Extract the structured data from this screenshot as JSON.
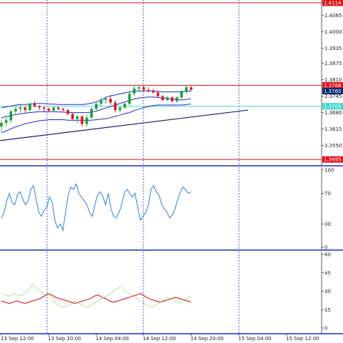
{
  "chart_data": [
    {
      "type": "candlestick",
      "panel": "price",
      "y_ticks": [
        "1.4065",
        "1.4000",
        "1.3935",
        "1.3875",
        "1.3810",
        "1.3745",
        "1.3680",
        "1.3615",
        "1.3550"
      ],
      "ylim": [
        1.347,
        1.4125
      ],
      "price_labels": [
        {
          "text": "1.4114",
          "value": 1.4114,
          "bg": "#e0141e"
        },
        {
          "text": "1.3788",
          "value": 1.3788,
          "bg": "#e0141e"
        },
        {
          "text": "1.3765",
          "value": 1.3765,
          "bg": "#0a2a6e"
        },
        {
          "text": "1.3705",
          "value": 1.3705,
          "bg": "#40d8d0"
        },
        {
          "text": "1.3495",
          "value": 1.3495,
          "bg": "#e0141e"
        }
      ],
      "horizontal_levels": [
        {
          "value": 1.4114,
          "color": "#e0141e"
        },
        {
          "value": 1.3788,
          "color": "#e0141e"
        },
        {
          "value": 1.3705,
          "color": "#40d8d0"
        },
        {
          "value": 1.3495,
          "color": "#e0141e"
        }
      ],
      "candles": [
        [
          1.3625,
          1.365,
          1.3605,
          1.364
        ],
        [
          1.364,
          1.366,
          1.3625,
          1.365
        ],
        [
          1.365,
          1.369,
          1.364,
          1.3685
        ],
        [
          1.3685,
          1.3705,
          1.367,
          1.3695
        ],
        [
          1.3695,
          1.371,
          1.368,
          1.37
        ],
        [
          1.37,
          1.3705,
          1.368,
          1.369
        ],
        [
          1.369,
          1.372,
          1.3685,
          1.3715
        ],
        [
          1.3715,
          1.3725,
          1.37,
          1.3705
        ],
        [
          1.3705,
          1.371,
          1.369,
          1.37
        ],
        [
          1.37,
          1.3705,
          1.3685,
          1.3695
        ],
        [
          1.3695,
          1.37,
          1.368,
          1.3688
        ],
        [
          1.3688,
          1.3705,
          1.3682,
          1.37
        ],
        [
          1.37,
          1.3705,
          1.369,
          1.3694
        ],
        [
          1.3694,
          1.37,
          1.3685,
          1.369
        ],
        [
          1.369,
          1.3695,
          1.367,
          1.3675
        ],
        [
          1.3675,
          1.368,
          1.365,
          1.3655
        ],
        [
          1.3655,
          1.367,
          1.364,
          1.3665
        ],
        [
          1.3665,
          1.367,
          1.3625,
          1.3635
        ],
        [
          1.3635,
          1.367,
          1.3625,
          1.366
        ],
        [
          1.366,
          1.37,
          1.3655,
          1.3695
        ],
        [
          1.3695,
          1.372,
          1.369,
          1.3715
        ],
        [
          1.3715,
          1.374,
          1.3705,
          1.373
        ],
        [
          1.373,
          1.3745,
          1.3715,
          1.3735
        ],
        [
          1.3735,
          1.375,
          1.371,
          1.372
        ],
        [
          1.372,
          1.373,
          1.368,
          1.369
        ],
        [
          1.369,
          1.3705,
          1.368,
          1.37
        ],
        [
          1.37,
          1.372,
          1.3695,
          1.3715
        ],
        [
          1.3715,
          1.376,
          1.371,
          1.3755
        ],
        [
          1.3755,
          1.379,
          1.3745,
          1.3775
        ],
        [
          1.3775,
          1.379,
          1.376,
          1.378
        ],
        [
          1.378,
          1.3785,
          1.3765,
          1.377
        ],
        [
          1.377,
          1.378,
          1.376,
          1.3765
        ],
        [
          1.3765,
          1.3775,
          1.3755,
          1.376
        ],
        [
          1.376,
          1.3765,
          1.374,
          1.3745
        ],
        [
          1.3745,
          1.375,
          1.3725,
          1.373
        ],
        [
          1.373,
          1.3745,
          1.3725,
          1.374
        ],
        [
          1.374,
          1.3745,
          1.372,
          1.3725
        ],
        [
          1.3725,
          1.3745,
          1.372,
          1.374
        ],
        [
          1.374,
          1.377,
          1.3735,
          1.3765
        ],
        [
          1.3765,
          1.379,
          1.3755,
          1.378
        ],
        [
          1.378,
          1.3785,
          1.3765,
          1.377
        ]
      ],
      "bands": {
        "upper": [
          1.37,
          1.3702,
          1.3706,
          1.371,
          1.3712,
          1.3712,
          1.3714,
          1.3716,
          1.3716,
          1.3716,
          1.3714,
          1.3714,
          1.3712,
          1.3712,
          1.3712,
          1.3712,
          1.3712,
          1.3712,
          1.3714,
          1.3718,
          1.3722,
          1.373,
          1.374,
          1.3746,
          1.375,
          1.3754,
          1.3758,
          1.3762,
          1.3765,
          1.3766,
          1.3766,
          1.3766,
          1.3766,
          1.3764,
          1.3762,
          1.3762,
          1.3762,
          1.3762,
          1.3762,
          1.3764,
          1.3766
        ],
        "middle": [
          1.366,
          1.3664,
          1.3668,
          1.3672,
          1.3675,
          1.3678,
          1.368,
          1.3682,
          1.3684,
          1.3684,
          1.3684,
          1.3684,
          1.3683,
          1.3682,
          1.3681,
          1.368,
          1.368,
          1.368,
          1.368,
          1.3682,
          1.3686,
          1.3692,
          1.3698,
          1.3704,
          1.371,
          1.3716,
          1.3722,
          1.3728,
          1.3734,
          1.3738,
          1.374,
          1.3742,
          1.3742,
          1.374,
          1.3738,
          1.3736,
          1.3734,
          1.3732,
          1.373,
          1.3732,
          1.3735
        ],
        "lower": [
          1.36,
          1.3608,
          1.3616,
          1.3624,
          1.363,
          1.3636,
          1.364,
          1.3644,
          1.3648,
          1.365,
          1.3652,
          1.3652,
          1.3652,
          1.3652,
          1.365,
          1.365,
          1.365,
          1.365,
          1.365,
          1.365,
          1.3652,
          1.3654,
          1.3656,
          1.366,
          1.3666,
          1.367,
          1.3676,
          1.368,
          1.3688,
          1.3694,
          1.37,
          1.3704,
          1.3708,
          1.371,
          1.371,
          1.371,
          1.371,
          1.371,
          1.371,
          1.3712,
          1.3714
        ]
      },
      "trendline": {
        "from": [
          -1.0,
          1.3568
        ],
        "to": [
          52.0,
          1.369
        ]
      }
    },
    {
      "type": "line",
      "panel": "oscillator",
      "y_ticks": [
        "100",
        "70",
        "30",
        "0"
      ],
      "ylim": [
        0,
        100
      ],
      "series": [
        {
          "values": [
            38,
            45,
            60,
            70,
            58,
            55,
            68,
            72,
            62,
            55,
            60,
            75,
            80,
            62,
            45,
            40,
            48,
            52,
            65,
            58,
            35,
            25,
            30,
            22,
            45,
            68,
            78,
            75,
            82,
            70,
            65,
            60,
            55,
            45,
            40,
            55,
            68,
            72,
            65,
            55,
            70,
            50,
            40,
            38,
            45,
            55,
            70,
            75,
            70,
            65,
            70,
            52,
            35,
            40,
            45,
            55,
            75,
            80,
            72,
            68,
            55,
            50,
            45,
            38,
            42,
            50,
            62,
            72,
            78,
            74,
            70,
            72
          ]
        }
      ]
    },
    {
      "type": "line",
      "panel": "adx",
      "y_ticks": [
        "60",
        "45",
        "30",
        "15",
        "0"
      ],
      "ylim": [
        0,
        60
      ],
      "series": [
        {
          "color": "#e0141e",
          "values": [
            22,
            21,
            20,
            21,
            22,
            21,
            20,
            21,
            22,
            23,
            24,
            26,
            28,
            27,
            25,
            24,
            23,
            22,
            21,
            20,
            21,
            22,
            23,
            24,
            26,
            27,
            25,
            24,
            22,
            21,
            22,
            23,
            24,
            25,
            26,
            27,
            28,
            26,
            24,
            23,
            22,
            21,
            22,
            23,
            24,
            25,
            24,
            23,
            22,
            21
          ]
        },
        {
          "color": "#88c840",
          "dash": true,
          "values": [
            28,
            27,
            26,
            28,
            27,
            26,
            28,
            30,
            36,
            32,
            30,
            28,
            27,
            26,
            20,
            18,
            17,
            18,
            20,
            22,
            20,
            18,
            17,
            18,
            20,
            22,
            24,
            26,
            28,
            30,
            32,
            34,
            30,
            28,
            26,
            24,
            22,
            20,
            18,
            17,
            19,
            21,
            23,
            25,
            24,
            22,
            20,
            22,
            24,
            26
          ]
        }
      ]
    }
  ],
  "x_labels": [
    "13 Sep 12:00",
    "13 Sep 20:00",
    "14 Sep 04:00",
    "14 Sep 12:00",
    "14 Sep 20:00",
    "15 Sep 04:00",
    "15 Sep 12:00"
  ],
  "colors": {
    "candle_up": "#18a030",
    "candle_down": "#e0141e",
    "bands": "#1a2acc",
    "trendline": "#1a2070",
    "oscillator": "#3a8ce0",
    "grid": "#1a2acc",
    "separator": "#1a2acc"
  }
}
